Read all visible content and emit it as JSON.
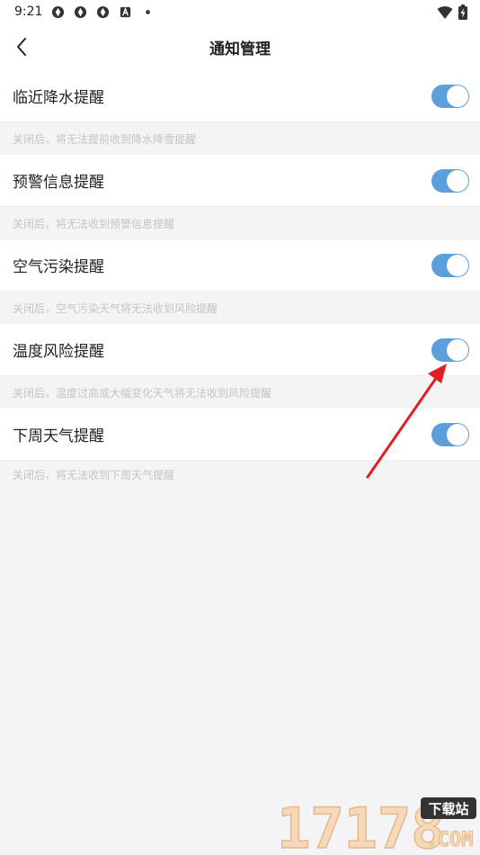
{
  "status_bar": {
    "time": "9:21",
    "left_icons": [
      "app-notification-icon",
      "app-notification-icon",
      "app-notification-icon",
      "alert-a-icon",
      "dot-icon"
    ],
    "right_icons": [
      "wifi-icon",
      "battery-charging-icon"
    ]
  },
  "header": {
    "title": "通知管理",
    "back_icon": "chevron-left-icon"
  },
  "settings": [
    {
      "label": "临近降水提醒",
      "enabled": true,
      "hint": "关闭后，将无法提前收到降水降雪提醒"
    },
    {
      "label": "预警信息提醒",
      "enabled": true,
      "hint": "关闭后，将无法收到预警信息提醒"
    },
    {
      "label": "空气污染提醒",
      "enabled": true,
      "hint": "关闭后，空气污染天气将无法收到风险提醒"
    },
    {
      "label": "温度风险提醒",
      "enabled": true,
      "hint": "关闭后，温度过高或大幅变化天气将无法收到风险提醒"
    },
    {
      "label": "下周天气提醒",
      "enabled": true,
      "hint": "关闭后，将无法收到下周天气提醒"
    }
  ],
  "colors": {
    "toggle_on": "#5c9fdc",
    "annotation_arrow": "#e02020",
    "background": "#f4f4f6"
  },
  "watermark": {
    "main": "17178",
    "sub": "下载站",
    "domain": ".COM"
  }
}
